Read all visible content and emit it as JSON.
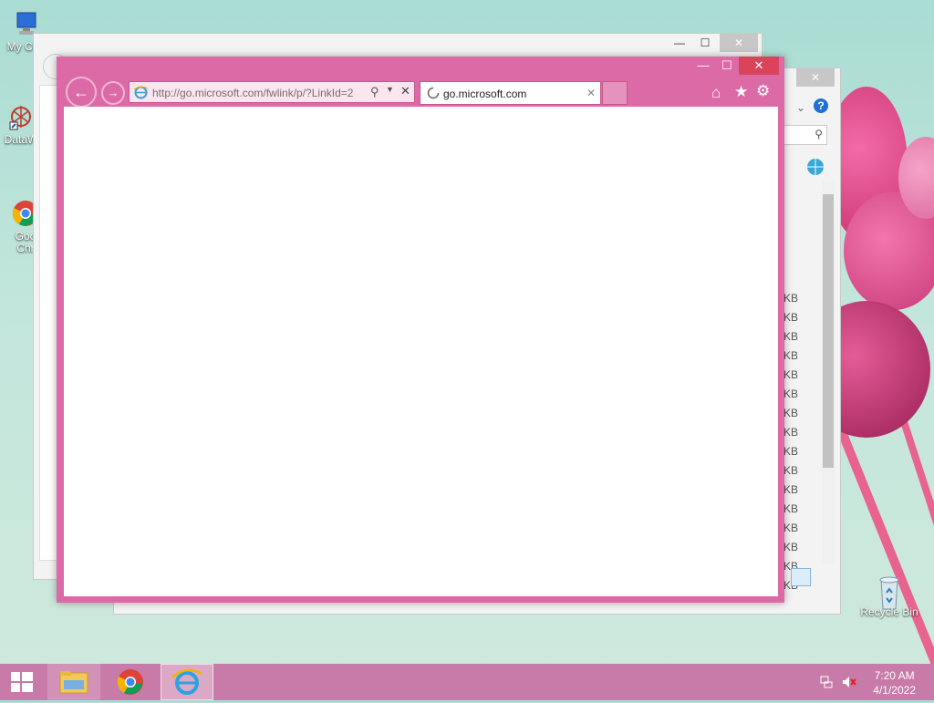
{
  "desktop": {
    "icons": [
      {
        "label": "My Co",
        "icon": "computer-icon"
      },
      {
        "label": "DataW",
        "icon": "datawarrior-icon"
      },
      {
        "label": "Goo Chr",
        "icon": "chrome-icon"
      },
      {
        "label": "Recycle Bin",
        "icon": "recycle-bin-icon"
      }
    ]
  },
  "explorer": {
    "file_sizes": [
      "KB",
      "KB",
      "KB",
      "KB",
      "KB",
      "KB",
      "KB",
      "KB",
      "KB",
      "KB",
      "KB",
      "KB",
      "KB",
      "KB",
      "KB",
      "KB"
    ],
    "minimize": "—",
    "maximize": "☐",
    "close": "✕"
  },
  "ie": {
    "address_url": "http://go.microsoft.com/fwlink/p/?LinkId=2",
    "tab_title": "go.microsoft.com",
    "buttons": {
      "back": "←",
      "forward": "→",
      "home": "⌂",
      "favorites": "★",
      "tools": "⚙",
      "search": "⚲",
      "stop": "✕",
      "tab_close": "✕"
    },
    "caption": {
      "minimize": "—",
      "maximize": "☐",
      "close": "✕"
    },
    "accent": "#dc6aa6"
  },
  "taskbar": {
    "apps": [
      {
        "name": "start",
        "icon": "windows-logo-icon"
      },
      {
        "name": "File Explorer",
        "icon": "folder-icon"
      },
      {
        "name": "Google Chrome",
        "icon": "chrome-icon"
      },
      {
        "name": "Internet Explorer",
        "icon": "ie-icon"
      }
    ],
    "clock_time": "7:20 AM",
    "clock_date": "4/1/2022"
  }
}
